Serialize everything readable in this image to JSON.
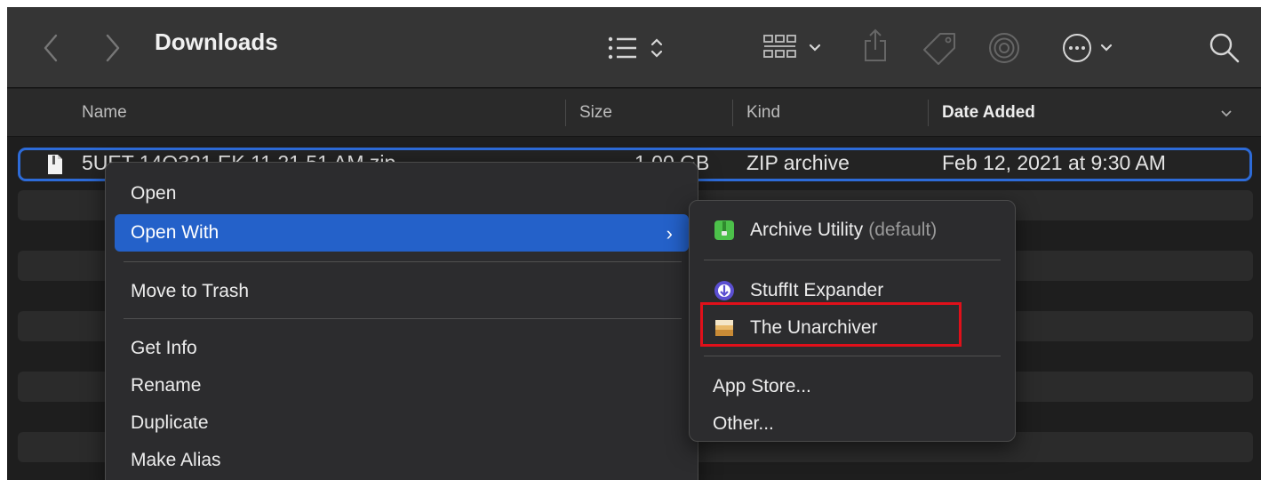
{
  "toolbar": {
    "title": "Downloads",
    "icons": [
      "back-icon",
      "forward-icon",
      "list-view-icon",
      "icon-grid-icon",
      "share-icon",
      "tag-icon",
      "airdrop-icon",
      "more-icon",
      "search-icon"
    ]
  },
  "columns": {
    "name": "Name",
    "size": "Size",
    "kind": "Kind",
    "date_added": "Date Added"
  },
  "file": {
    "name": "5UET 14O321 EK 11 21 51 AM.zip",
    "size": "1.00 GB",
    "kind": "ZIP archive",
    "date_added": "Feb 12, 2021 at 9:30 AM"
  },
  "context_menu": {
    "open": "Open",
    "open_with": "Open With",
    "move_to_trash": "Move to Trash",
    "get_info": "Get Info",
    "rename": "Rename",
    "duplicate": "Duplicate",
    "make_alias": "Make Alias",
    "submenu_arrow": "›"
  },
  "open_with_submenu": {
    "archive_utility": "Archive Utility",
    "archive_utility_suffix": "(default)",
    "stuffit_expander": "StuffIt Expander",
    "the_unarchiver": "The Unarchiver",
    "app_store": "App Store...",
    "other": "Other..."
  },
  "colors": {
    "accent": "#2461c9",
    "selection_border": "#2d6bd8",
    "highlight_annotation": "#e0101a"
  }
}
